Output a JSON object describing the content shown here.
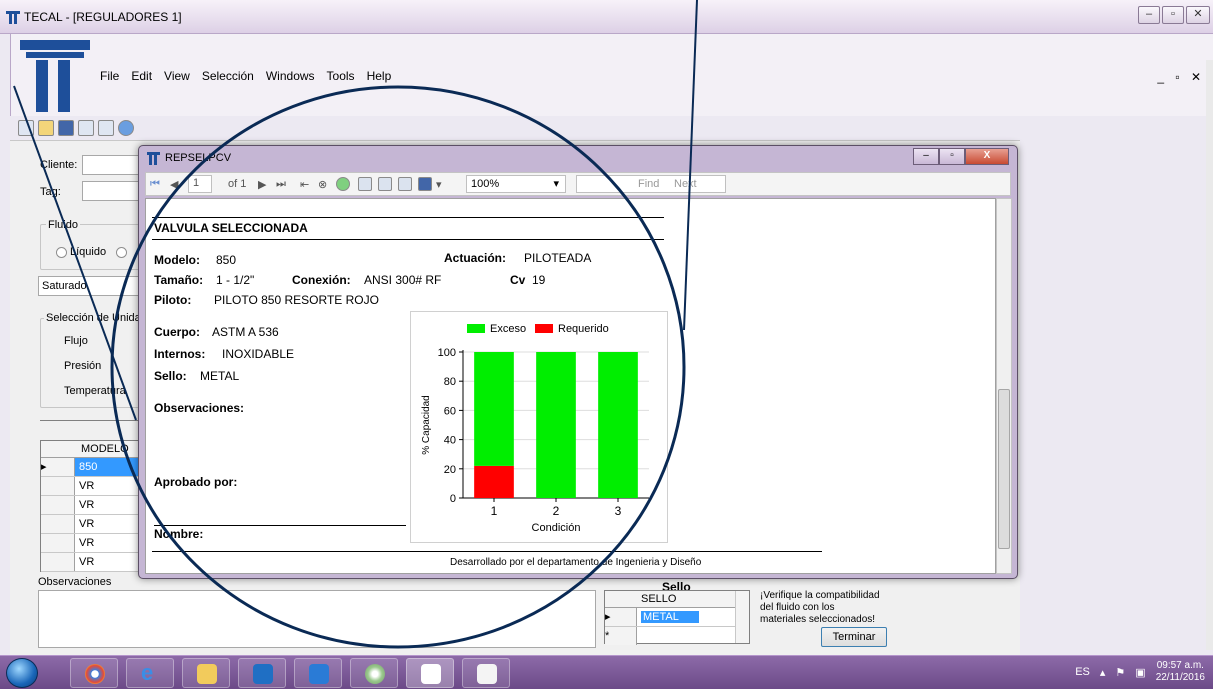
{
  "main_window": {
    "title": "TECAL - [REGULADORES 1]",
    "menu": [
      "File",
      "Edit",
      "View",
      "Selección",
      "Windows",
      "Tools",
      "Help"
    ]
  },
  "form": {
    "cliente_label": "Cliente:",
    "tag_label": "Tag:",
    "fluido_group": "Fluido",
    "liquido_label": "Líquido",
    "saturado_value": "Saturado",
    "unidades_group": "Selección de Unidades",
    "flujo_label": "Flujo",
    "presion_label": "Presión",
    "temperatura_label": "Temperatura",
    "models_header": "MODELO",
    "models": [
      "850",
      "VR",
      "VR",
      "VR",
      "VR",
      "VR"
    ],
    "observaciones_label": "Observaciones",
    "sello_header": "Sello",
    "sello_col": "SELLO",
    "sello_selected": "METAL",
    "warning": "¡Verifique la compatibilidad del fluido con los materiales seleccionados!",
    "terminar": "Terminar"
  },
  "report_window": {
    "title": "REPSELPCV",
    "toolbar": {
      "page": "1",
      "of_pages": "of 1",
      "zoom": "100%",
      "find": "Find",
      "next": "Next"
    },
    "heading": "VALVULA SELECCIONADA",
    "modelo_label": "Modelo:",
    "modelo_value": "850",
    "actuacion_label": "Actuación:",
    "actuacion_value": "PILOTEADA",
    "tamano_label": "Tamaño:",
    "tamano_value": "1 - 1/2\"",
    "conexion_label": "Conexión:",
    "conexion_value": "ANSI 300# RF",
    "cv_label": "Cv",
    "cv_value": "19",
    "piloto_label": "Piloto:",
    "piloto_value": "PILOTO 850 RESORTE ROJO",
    "cuerpo_label": "Cuerpo:",
    "cuerpo_value": "ASTM A 536",
    "internos_label": "Internos:",
    "internos_value": "INOXIDABLE",
    "sello_label": "Sello:",
    "sello_value": "METAL",
    "observaciones_label": "Observaciones:",
    "aprobado_label": "Aprobado por:",
    "nombre_label": "Nombre:",
    "footer": "Desarrollado por el departamento de Ingenieria y Diseño"
  },
  "chart_data": {
    "type": "bar",
    "stacked": true,
    "categories": [
      "1",
      "2",
      "3"
    ],
    "series": [
      {
        "name": "Requerido",
        "color": "#ff0000",
        "values": [
          22,
          0,
          0
        ]
      },
      {
        "name": "Exceso",
        "color": "#00ee00",
        "values": [
          78,
          100,
          100
        ]
      }
    ],
    "xlabel": "Condición",
    "ylabel": "% Capacidad",
    "ylim": [
      0,
      100
    ],
    "yticks": [
      0,
      20,
      40,
      60,
      80,
      100
    ],
    "legend": "top",
    "grid": true
  },
  "taskbar": {
    "lang": "ES",
    "time": "09:57 a.m.",
    "date": "22/11/2016"
  }
}
